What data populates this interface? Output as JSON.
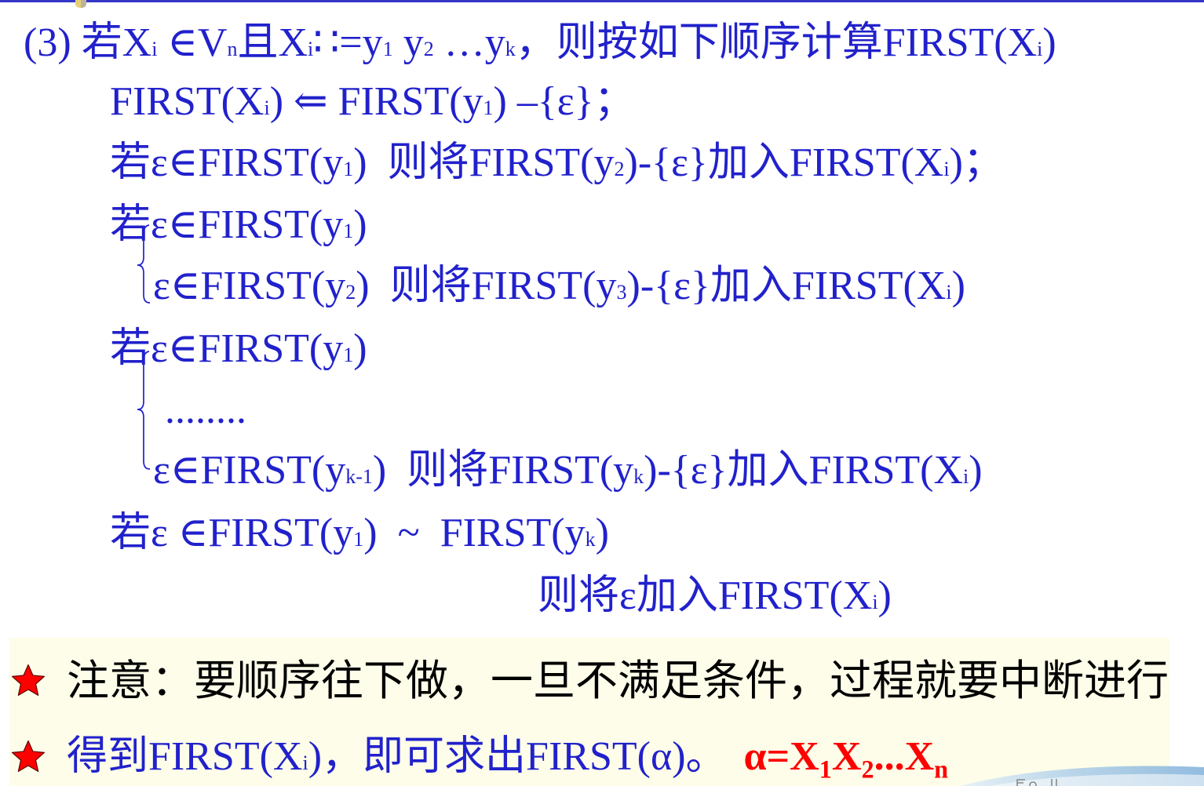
{
  "theme": {
    "text_blue": "#2121cc",
    "note_ink": "#000000",
    "accent_red": "#ff0000",
    "panel_bg": "#fdfde9",
    "rule_blue": "#3636c8"
  },
  "rule": {
    "heading": [
      {
        "text": "(3) 若X"
      },
      {
        "sub": "i"
      },
      {
        "text": " ∈V"
      },
      {
        "sub": "n"
      },
      {
        "text": "且X"
      },
      {
        "sub": "i"
      },
      {
        "text": "∷=y"
      },
      {
        "sub": "1"
      },
      {
        "text": " y"
      },
      {
        "sub": "2"
      },
      {
        "text": " …y"
      },
      {
        "sub": "k"
      },
      {
        "text": "，则按如下顺序计算FIRST(X"
      },
      {
        "sub": "i"
      },
      {
        "text": ")"
      }
    ],
    "steps": [
      [
        {
          "text": "FIRST(X"
        },
        {
          "sub": "i"
        },
        {
          "text": ") ⇐ FIRST(y"
        },
        {
          "sub": "1"
        },
        {
          "text": ") –{ε}；"
        }
      ],
      [
        {
          "text": "若ε∈FIRST(y"
        },
        {
          "sub": "1"
        },
        {
          "text": ")  则将FIRST(y"
        },
        {
          "sub": "2"
        },
        {
          "text": ")-{ε}加入FIRST(X"
        },
        {
          "sub": "i"
        },
        {
          "text": ")；"
        }
      ],
      [
        {
          "text": "若ε∈FIRST(y"
        },
        {
          "sub": "1"
        },
        {
          "text": ")"
        }
      ],
      [
        {
          "text": "ε∈FIRST(y"
        },
        {
          "sub": "2"
        },
        {
          "text": ")  则将FIRST(y"
        },
        {
          "sub": "3"
        },
        {
          "text": ")-{ε}加入FIRST(X"
        },
        {
          "sub": "i"
        },
        {
          "text": ")"
        }
      ],
      [
        {
          "text": "若ε∈FIRST(y"
        },
        {
          "sub": "1"
        },
        {
          "text": ")"
        }
      ],
      [
        {
          "text": "........"
        }
      ],
      [
        {
          "text": "ε∈FIRST(y"
        },
        {
          "sub": "k-1"
        },
        {
          "text": ")  则将FIRST(y"
        },
        {
          "sub": "k"
        },
        {
          "text": ")-{ε}加入FIRST(X"
        },
        {
          "sub": "i"
        },
        {
          "text": ")"
        }
      ],
      [
        {
          "text": "若ε ∈FIRST(y"
        },
        {
          "sub": "1"
        },
        {
          "text": ")  ~  FIRST(y"
        },
        {
          "sub": "k"
        },
        {
          "text": ")"
        }
      ],
      [
        {
          "text": "则将ε加入FIRST(X"
        },
        {
          "sub": "i"
        },
        {
          "text": ")"
        }
      ]
    ]
  },
  "notes": [
    {
      "icon": "star-icon",
      "segs": [
        {
          "text": "注意：要顺序往下做，一旦不满足条件，过程就要中断进行"
        }
      ]
    },
    {
      "icon": "star-icon",
      "segs": [
        {
          "text": "得到FIRST(X"
        },
        {
          "sub": "i"
        },
        {
          "text": ")，即可求出FIRST(α)。"
        }
      ],
      "formula": [
        {
          "text": "α=X"
        },
        {
          "sub": "1"
        },
        {
          "text": "X"
        },
        {
          "sub": "2"
        },
        {
          "text": "...X"
        },
        {
          "sub": "n"
        }
      ]
    }
  ]
}
